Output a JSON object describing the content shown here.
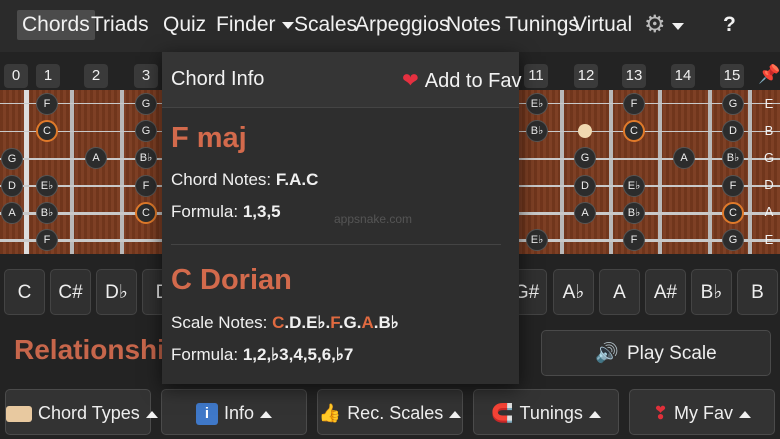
{
  "nav": {
    "items": [
      {
        "label": "Chords",
        "active": true
      },
      {
        "label": "Triads"
      },
      {
        "label": "Quiz"
      },
      {
        "label": "Finder",
        "dropdown": true
      },
      {
        "label": "Scales"
      },
      {
        "label": "Arpeggios"
      },
      {
        "label": "Notes"
      },
      {
        "label": "Tunings"
      },
      {
        "label": "Virtual"
      }
    ],
    "settings_icon": "gear-icon",
    "help_label": "?"
  },
  "fret_numbers": [
    "0",
    "1",
    "2",
    "3",
    "11",
    "12",
    "13",
    "14",
    "15"
  ],
  "strings": {
    "left_open": [
      "G",
      "D",
      "A"
    ],
    "right_open": [
      "E",
      "B",
      "G",
      "D",
      "A",
      "E"
    ]
  },
  "board_notes": {
    "left": [
      {
        "label": "F",
        "root": false
      },
      {
        "label": "C",
        "root": true
      },
      {
        "label": "G",
        "root": false
      },
      {
        "label": "G",
        "root": false
      },
      {
        "label": "A",
        "root": false
      },
      {
        "label": "B♭",
        "root": false
      },
      {
        "label": "E♭",
        "root": false
      },
      {
        "label": "F",
        "root": false
      },
      {
        "label": "B♭",
        "root": false
      },
      {
        "label": "C",
        "root": true
      },
      {
        "label": "F",
        "root": false
      }
    ],
    "right": [
      {
        "label": "E♭",
        "root": false
      },
      {
        "label": "F",
        "root": false
      },
      {
        "label": "G",
        "root": false
      },
      {
        "label": "B♭",
        "root": false
      },
      {
        "label": "C",
        "root": true
      },
      {
        "label": "D",
        "root": false
      },
      {
        "label": "G",
        "root": false
      },
      {
        "label": "A",
        "root": false
      },
      {
        "label": "B♭",
        "root": false
      },
      {
        "label": "D",
        "root": false
      },
      {
        "label": "E♭",
        "root": false
      },
      {
        "label": "F",
        "root": false
      },
      {
        "label": "A",
        "root": false
      },
      {
        "label": "B♭",
        "root": false
      },
      {
        "label": "C",
        "root": true
      },
      {
        "label": "E♭",
        "root": false
      },
      {
        "label": "F",
        "root": false
      },
      {
        "label": "G",
        "root": false
      }
    ]
  },
  "chord_buttons": {
    "left": [
      "C",
      "C#",
      "D♭",
      "D"
    ],
    "right": [
      "G#",
      "A♭",
      "A",
      "A#",
      "B♭",
      "B"
    ]
  },
  "relationship_label": "Relationship:",
  "play_scale_label": "Play Scale",
  "bottom_bar": {
    "chord_types": "Chord Types",
    "info": "Info",
    "rec_scales": "Rec. Scales",
    "tunings": "Tunings",
    "my_fav": "My Fav"
  },
  "popup": {
    "title": "Chord Info",
    "fav_label": "Add to Fav",
    "chord_name": "F maj",
    "chord_notes_label": "Chord Notes:",
    "chord_notes_value": "F.A.C",
    "formula_label": "Formula:",
    "chord_formula": "1,3,5",
    "scale_name": "C Dorian",
    "scale_notes_label": "Scale Notes:",
    "scale_notes": [
      {
        "note": "C",
        "highlight": true
      },
      {
        "note": "D",
        "highlight": false
      },
      {
        "note": "E♭",
        "highlight": false
      },
      {
        "note": "F",
        "highlight": true
      },
      {
        "note": "G",
        "highlight": false
      },
      {
        "note": "A",
        "highlight": true
      },
      {
        "note": "B♭",
        "highlight": false
      }
    ],
    "scale_formula": "1,2,♭3,4,5,6,♭7",
    "watermark": "appsnake.com"
  },
  "colors": {
    "accent": "#d36a4c",
    "highlight": "#e06a40",
    "fretboard": "#7a3a1e",
    "heart": "#e53040"
  }
}
